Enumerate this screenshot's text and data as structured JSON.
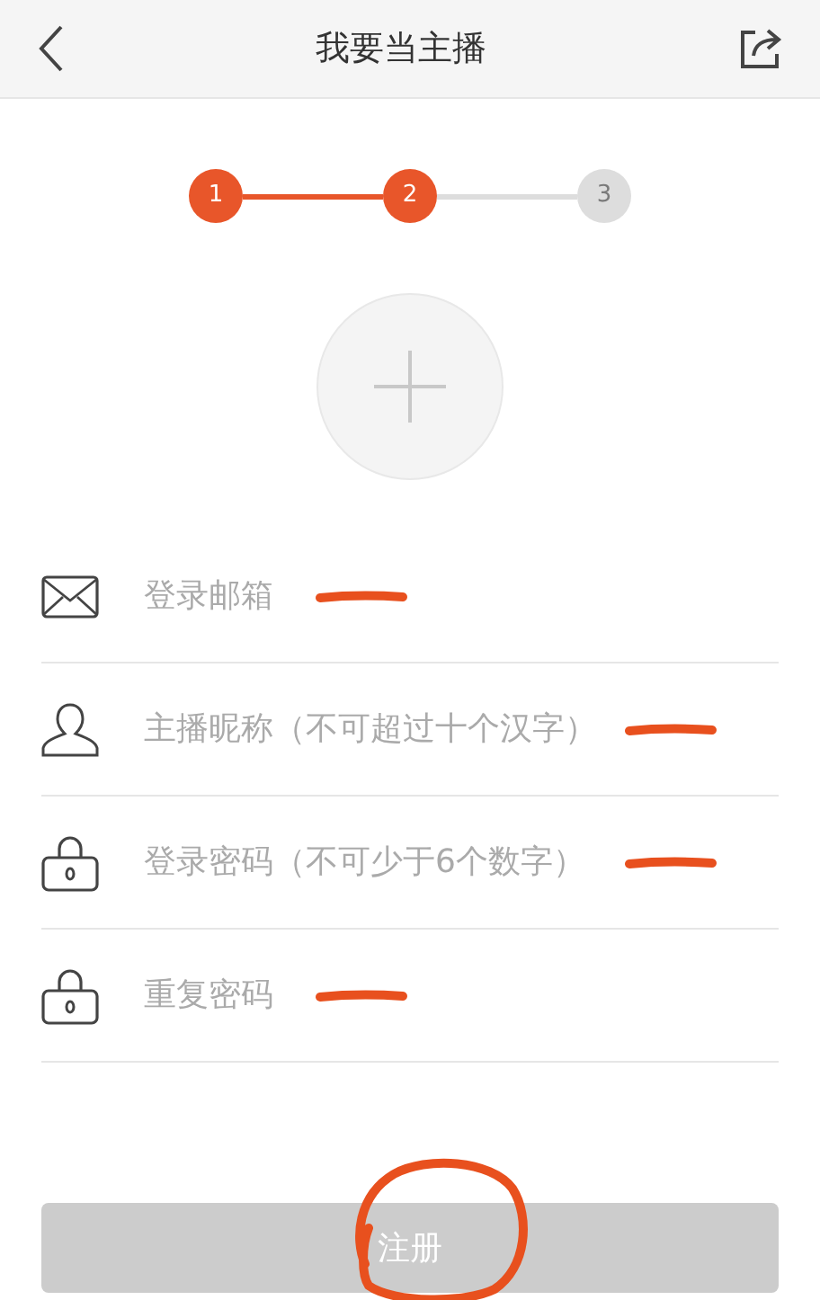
{
  "header": {
    "title": "我要当主播"
  },
  "steps": [
    {
      "label": "1",
      "done": true
    },
    {
      "label": "2",
      "done": true
    },
    {
      "label": "3",
      "done": false
    }
  ],
  "fields": [
    {
      "kind": "email",
      "placeholder": "登录邮箱",
      "underlined": true
    },
    {
      "kind": "user",
      "placeholder": "主播昵称（不可超过十个汉字）",
      "underlined": true
    },
    {
      "kind": "lock",
      "placeholder": "登录密码（不可少于6个数字）",
      "underlined": true
    },
    {
      "kind": "lock",
      "placeholder": "重复密码",
      "underlined": true
    }
  ],
  "submit": {
    "label": "注册",
    "disabled": true,
    "circled": true
  }
}
